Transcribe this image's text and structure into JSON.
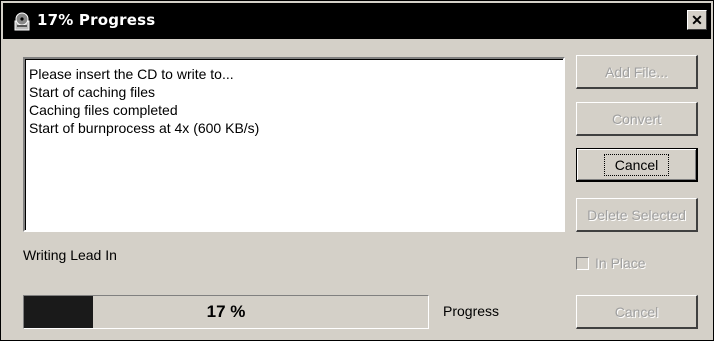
{
  "window": {
    "title": "17% Progress",
    "title_icon": "cd-burner-icon",
    "close_label": "✕"
  },
  "log": {
    "lines": [
      "Please insert the CD to write to...",
      "Start of caching files",
      "Caching files completed",
      "Start of burnprocess at 4x (600 KB/s)"
    ]
  },
  "buttons": {
    "add_file": "Add File...",
    "convert": "Convert",
    "cancel": "Cancel",
    "delete_selected": "Delete Selected",
    "cancel_disabled": "Cancel"
  },
  "status": {
    "text": "Writing Lead In"
  },
  "options": {
    "in_place_label": "In Place",
    "in_place_checked": false
  },
  "progress": {
    "value": 0.17,
    "text": "17 %",
    "label": "Progress"
  }
}
